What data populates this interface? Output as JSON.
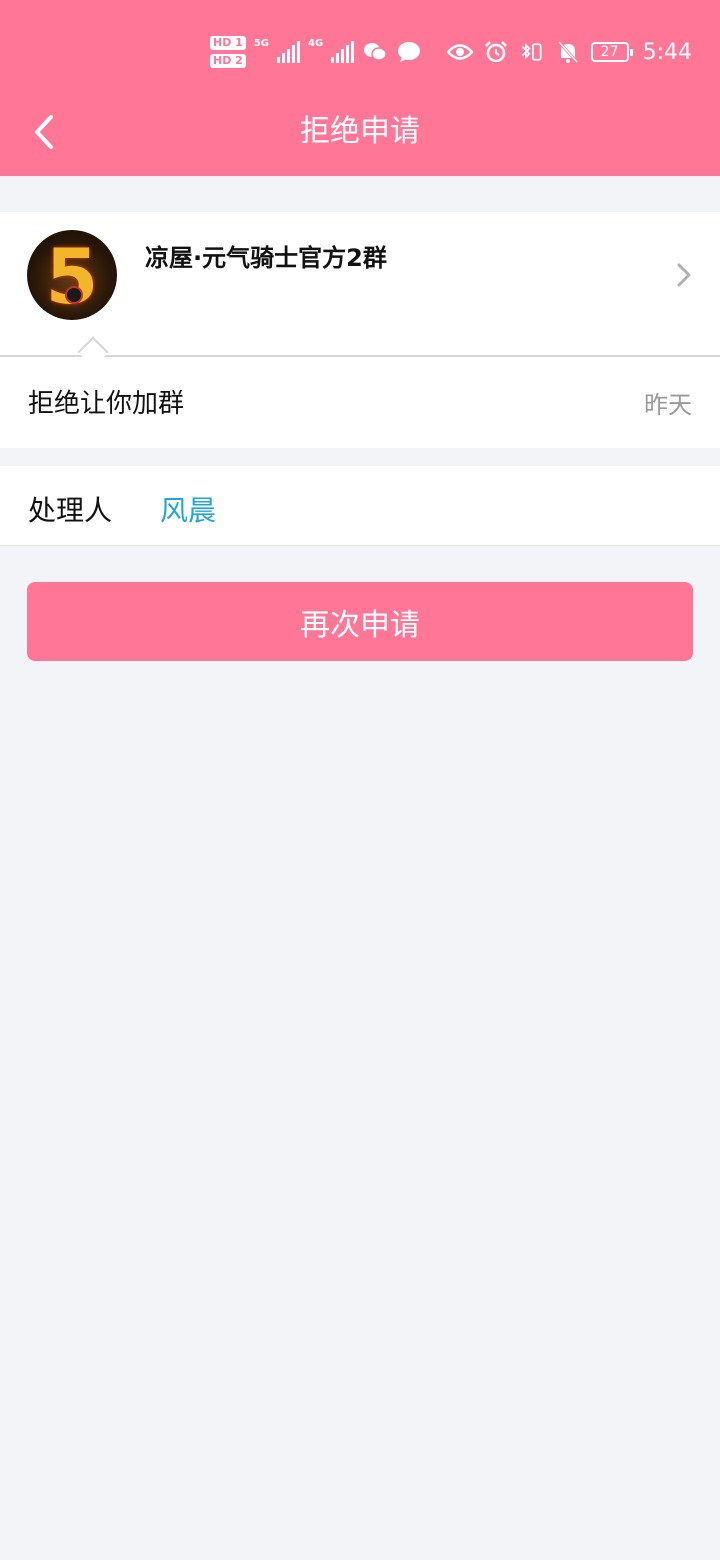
{
  "status_bar": {
    "hd1": "HD 1",
    "hd2": "HD 2",
    "sig1_label": "5G",
    "sig2_label": "4G",
    "battery": "27",
    "time": "5:44"
  },
  "header": {
    "title": "拒绝申请",
    "background": "#ff7697"
  },
  "group": {
    "name": "凉屋·元气骑士官方2群",
    "avatar_text": "5"
  },
  "status": {
    "message": "拒绝让你加群",
    "time": "昨天"
  },
  "handler": {
    "label": "处理人",
    "name": "风晨",
    "name_color": "#21a6d6"
  },
  "actions": {
    "reapply_label": "再次申请"
  },
  "icons": [
    "back-arrow-icon",
    "wechat-icon",
    "message-icon",
    "eye-icon",
    "alarm-icon",
    "bluetooth-icon",
    "vibrate-icon",
    "mute-bell-icon",
    "battery-icon",
    "chevron-right-icon"
  ]
}
